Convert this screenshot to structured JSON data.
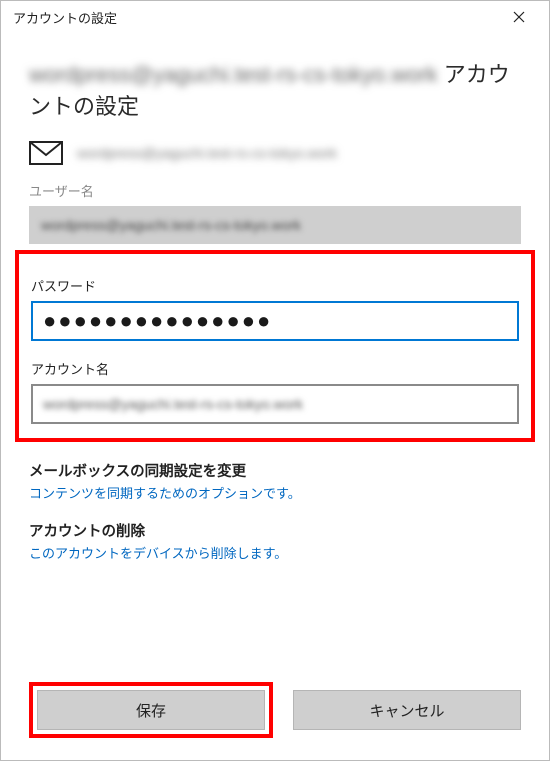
{
  "window": {
    "title": "アカウントの設定"
  },
  "heading": {
    "email_masked": "wordpress@yaguchi.test-rs-cs-tokyo.work",
    "suffix": " アカウントの設定"
  },
  "mail_row": {
    "email_masked": "wordpress@yaguchi.test-rs-cs-tokyo.work"
  },
  "username": {
    "label": "ユーザー名",
    "value_masked": "wordpress@yaguchi.test-rs-cs-tokyo.work"
  },
  "password": {
    "label": "パスワード",
    "value_dots": "●●●●●●●●●●●●●●●"
  },
  "account_name": {
    "label": "アカウント名",
    "value_masked": "wordpress@yaguchi.test-rs-cs-tokyo.work"
  },
  "sync": {
    "title": "メールボックスの同期設定を変更",
    "desc": "コンテンツを同期するためのオプションです。"
  },
  "delete": {
    "title": "アカウントの削除",
    "desc": "このアカウントをデバイスから削除します。"
  },
  "buttons": {
    "save": "保存",
    "cancel": "キャンセル"
  }
}
